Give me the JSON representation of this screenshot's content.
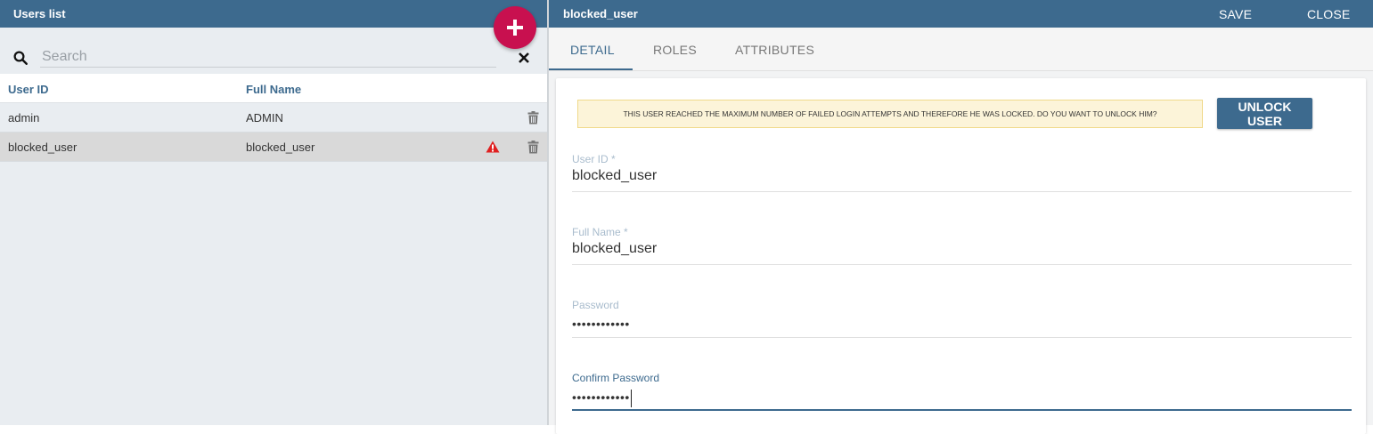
{
  "users_list": {
    "title": "Users list",
    "search": {
      "placeholder": "Search",
      "value": ""
    },
    "columns": {
      "user_id": "User ID",
      "full_name": "Full Name"
    },
    "rows": [
      {
        "user_id": "admin",
        "full_name": "ADMIN",
        "blocked": false
      },
      {
        "user_id": "blocked_user",
        "full_name": "blocked_user",
        "blocked": true
      }
    ],
    "icons": {
      "add": "plus-icon",
      "search": "search-icon",
      "clear": "close-icon",
      "delete": "trash-icon",
      "blocked": "warning-icon"
    }
  },
  "detail": {
    "title": "blocked_user",
    "save_label": "SAVE",
    "close_label": "CLOSE",
    "tabs": [
      {
        "label": "DETAIL",
        "active": true
      },
      {
        "label": "ROLES",
        "active": false
      },
      {
        "label": "ATTRIBUTES",
        "active": false
      }
    ],
    "alert_text": "THIS USER REACHED THE MAXIMUM NUMBER OF FAILED LOGIN ATTEMPTS AND THEREFORE HE WAS LOCKED. DO YOU WANT TO UNLOCK HIM?",
    "unlock_label": "UNLOCK USER",
    "fields": {
      "user_id": {
        "label": "User ID *",
        "value": "blocked_user"
      },
      "full_name": {
        "label": "Full Name *",
        "value": "blocked_user"
      },
      "password": {
        "label": "Password",
        "value": "••••••••••••"
      },
      "confirm_password": {
        "label": "Confirm Password",
        "value": "••••••••••••"
      }
    }
  },
  "colors": {
    "header": "#3d6a8e",
    "fab": "#c8104f",
    "warning": "#e02020",
    "alert_bg": "#fcf4d9"
  }
}
